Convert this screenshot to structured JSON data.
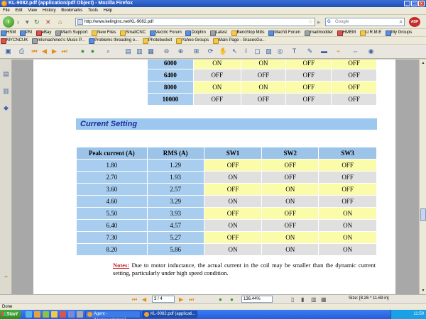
{
  "window": {
    "title": "KL-9082.pdf (application/pdf Object) - Mozilla Firefox"
  },
  "menu": [
    "File",
    "Edit",
    "View",
    "History",
    "Bookmarks",
    "Tools",
    "Help"
  ],
  "nav": {
    "url": "http://www.kelinginc.net/KL-9082.pdf",
    "search_placeholder": "Google",
    "abp": "ABP"
  },
  "bookmarks_row1": [
    "HSM",
    "PM",
    "eBay",
    "Mach Support",
    "New Files",
    "SmallCNC",
    "Vectric Forum",
    "Dolphin",
    "Latest",
    "Benchtop Mills",
    "Mach3 Forum",
    "madmodder",
    "HMEM",
    "U.R.M.E",
    "My Groups"
  ],
  "bookmarks_row2": [
    "MYCNCUK",
    "mlsmachines's Music P...",
    "Problems threading o...",
    "Photobucket",
    "Yahoo Groups",
    "Main Page - GracesGu..."
  ],
  "document": {
    "top_table": {
      "rows": [
        {
          "hz": "6000",
          "sw": [
            "ON",
            "ON",
            "OFF",
            "OFF"
          ],
          "style": "y"
        },
        {
          "hz": "6400",
          "sw": [
            "OFF",
            "OFF",
            "OFF",
            "OFF"
          ],
          "style": "g"
        },
        {
          "hz": "8000",
          "sw": [
            "ON",
            "ON",
            "OFF",
            "OFF"
          ],
          "style": "y"
        },
        {
          "hz": "10000",
          "sw": [
            "OFF",
            "OFF",
            "OFF",
            "OFF"
          ],
          "style": "g"
        }
      ]
    },
    "section_heading": "Current Setting",
    "current_table": {
      "headers": [
        "Peak current (A)",
        "RMS (A)",
        "SW1",
        "SW2",
        "SW3"
      ],
      "rows": [
        [
          "1.80",
          "1.29",
          "OFF",
          "OFF",
          "OFF"
        ],
        [
          "2.70",
          "1.93",
          "ON",
          "OFF",
          "OFF"
        ],
        [
          "3.60",
          "2.57",
          "OFF",
          "ON",
          "OFF"
        ],
        [
          "4.60",
          "3.29",
          "ON",
          "ON",
          "OFF"
        ],
        [
          "5.50",
          "3.93",
          "OFF",
          "OFF",
          "ON"
        ],
        [
          "6.40",
          "4.57",
          "ON",
          "OFF",
          "ON"
        ],
        [
          "7.30",
          "5.27",
          "OFF",
          "ON",
          "ON"
        ],
        [
          "8.20",
          "5.86",
          "ON",
          "ON",
          "ON"
        ]
      ]
    },
    "notes_label": "Notes:",
    "notes_text": " Due to motor inductance, the actual current in the coil may be smaller than the dynamic current setting, particularly under high speed condition."
  },
  "pdf_nav": {
    "page": "3 / 4",
    "zoom": "136.44%",
    "size": "Size: [8.26 * 11.69 in]"
  },
  "status": "Done",
  "taskbar": {
    "start": "Start",
    "tasks": [
      "Agent - [Homeworkshop]",
      "KL-9082.pdf (applicati..."
    ],
    "clock": "11:59"
  },
  "colors": {
    "header_blue": "#9cc3e8",
    "row_yellow": "#fbfcaa",
    "row_grey": "#e0e0e0",
    "heading_text": "#1a2b9a",
    "notes_red": "#c32020"
  }
}
